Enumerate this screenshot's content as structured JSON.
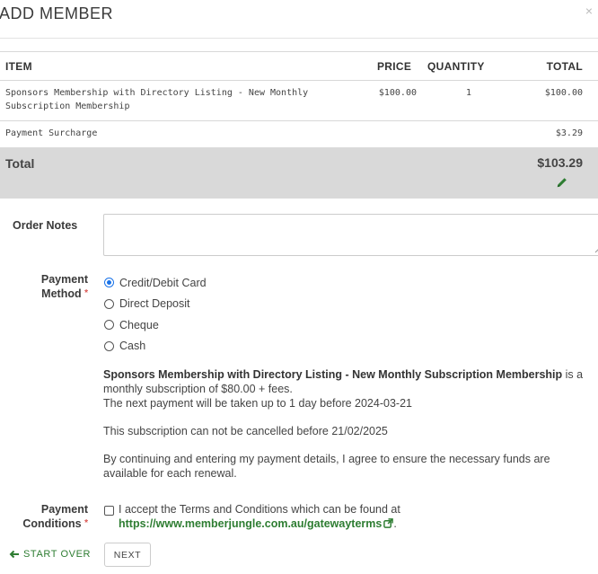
{
  "modal": {
    "title": "ADD MEMBER",
    "close_glyph": "×"
  },
  "order_table": {
    "headers": {
      "item": "ITEM",
      "price": "PRICE",
      "quantity": "QUANTITY",
      "total": "TOTAL"
    },
    "rows": [
      {
        "item": "Sponsors Membership with Directory Listing - New Monthly Subscription Membership",
        "price": "$100.00",
        "quantity": "1",
        "total": "$100.00"
      },
      {
        "item": "Payment Surcharge",
        "price": "",
        "quantity": "",
        "total": "$3.29"
      }
    ],
    "total_label": "Total",
    "total_value": "$103.29"
  },
  "order_notes": {
    "label": "Order Notes",
    "value": "",
    "placeholder": ""
  },
  "payment_method": {
    "label_line1": "Payment",
    "label_line2": "Method",
    "required_mark": "*",
    "options": [
      {
        "label": "Credit/Debit Card",
        "selected": true
      },
      {
        "label": "Direct Deposit",
        "selected": false
      },
      {
        "label": "Cheque",
        "selected": false
      },
      {
        "label": "Cash",
        "selected": false
      }
    ]
  },
  "subscription_info": {
    "product_name": "Sponsors Membership with Directory Listing - New Monthly Subscription Membership",
    "suffix_line1": " is a",
    "line2": "monthly subscription of $80.00 + fees.",
    "line3": "The next payment will be taken up to 1 day before 2024-03-21",
    "cancel_note": "This subscription can not be cancelled before 21/02/2025",
    "agree_line1": "By continuing and entering my payment details, I agree to ensure the necessary funds are",
    "agree_line2": "available for each renewal."
  },
  "payment_conditions": {
    "label_line1": "Payment",
    "label_line2": "Conditions",
    "required_mark": "*",
    "terms_text": "I accept the Terms and Conditions which can be found at",
    "terms_link": "https://www.memberjungle.com.au/gatewayterms",
    "terms_end": ".",
    "accepted": false
  },
  "footer": {
    "start_over_label": "START OVER",
    "next_label": "NEXT"
  },
  "colors": {
    "accent_green": "#2e7d32",
    "radio_blue": "#1a73e8",
    "total_bar": "#d9d9d9",
    "required_red": "#d9534f"
  },
  "icons": {
    "close": "close-icon",
    "edit": "pencil-icon",
    "external": "external-link-icon",
    "back": "arrow-left-icon"
  }
}
